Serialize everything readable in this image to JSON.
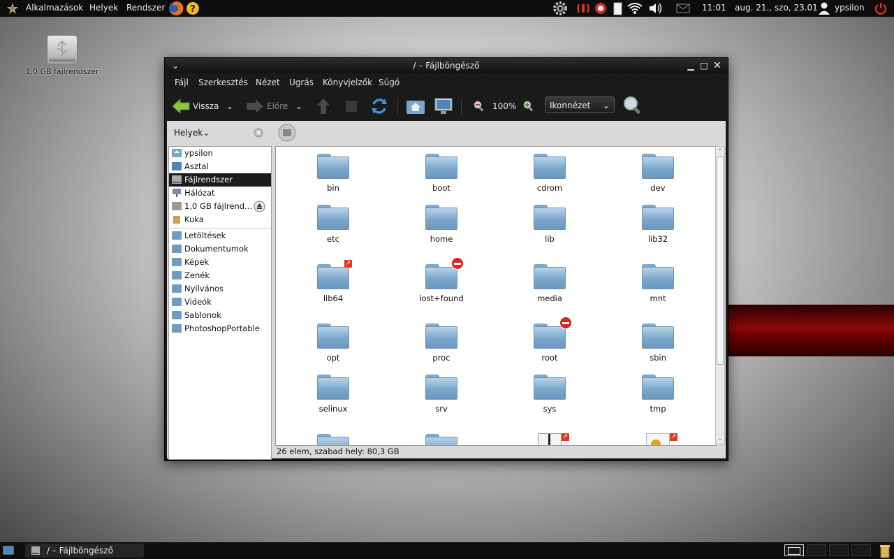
{
  "top_panel": {
    "menus": [
      "Alkalmazások",
      "Helyek",
      "Rendszer"
    ],
    "time": "11:01",
    "date": "aug. 21., szo, 23.01",
    "user": "ypsilon"
  },
  "desktop": {
    "icon_label": "1,0 GB fájlrendszer"
  },
  "window": {
    "title": "/ – Fájlböngésző",
    "menu": [
      "Fájl",
      "Szerkesztés",
      "Nézet",
      "Ugrás",
      "Könyvjelzők",
      "Súgó"
    ],
    "toolbar": {
      "back_label": "Vissza",
      "forward_label": "Előre",
      "zoom": "100%",
      "view_mode": "Ikonnézet"
    },
    "sidebar_header": "Helyek",
    "places": [
      {
        "label": "ypsilon",
        "icon": "home-icon"
      },
      {
        "label": "Asztal",
        "icon": "desktop-icon"
      },
      {
        "label": "Fájlrendszer",
        "icon": "drive-icon",
        "selected": true
      },
      {
        "label": "Hálózat",
        "icon": "network-icon"
      },
      {
        "label": "1,0 GB fájlrend...",
        "icon": "usb-drive-icon",
        "eject": true
      },
      {
        "label": "Kuka",
        "icon": "trash-icon"
      }
    ],
    "bookmarks": [
      "Letöltések",
      "Dokumentumok",
      "Képek",
      "Zenék",
      "Nyilvános",
      "Videók",
      "Sablonok",
      "PhotoshopPortable"
    ],
    "files": [
      {
        "name": "bin"
      },
      {
        "name": "boot"
      },
      {
        "name": "cdrom"
      },
      {
        "name": "dev"
      },
      {
        "name": "etc"
      },
      {
        "name": "home"
      },
      {
        "name": "lib"
      },
      {
        "name": "lib32"
      },
      {
        "name": "lib64",
        "badge": "link"
      },
      {
        "name": "lost+found",
        "badge": "no-access"
      },
      {
        "name": "media"
      },
      {
        "name": "mnt"
      },
      {
        "name": "opt"
      },
      {
        "name": "proc"
      },
      {
        "name": "root",
        "badge": "no-access"
      },
      {
        "name": "sbin"
      },
      {
        "name": "selinux"
      },
      {
        "name": "srv"
      },
      {
        "name": "sys"
      },
      {
        "name": "tmp"
      }
    ],
    "status": "26 elem, szabad hely: 80,3 GB"
  },
  "taskbar": {
    "task_label": "/ – Fájlböngésző"
  },
  "colors": {
    "panel": "#0d0d0d",
    "folder": "#7aa6cb",
    "badge_red": "#d9261c",
    "power_red": "#e02b1d"
  }
}
